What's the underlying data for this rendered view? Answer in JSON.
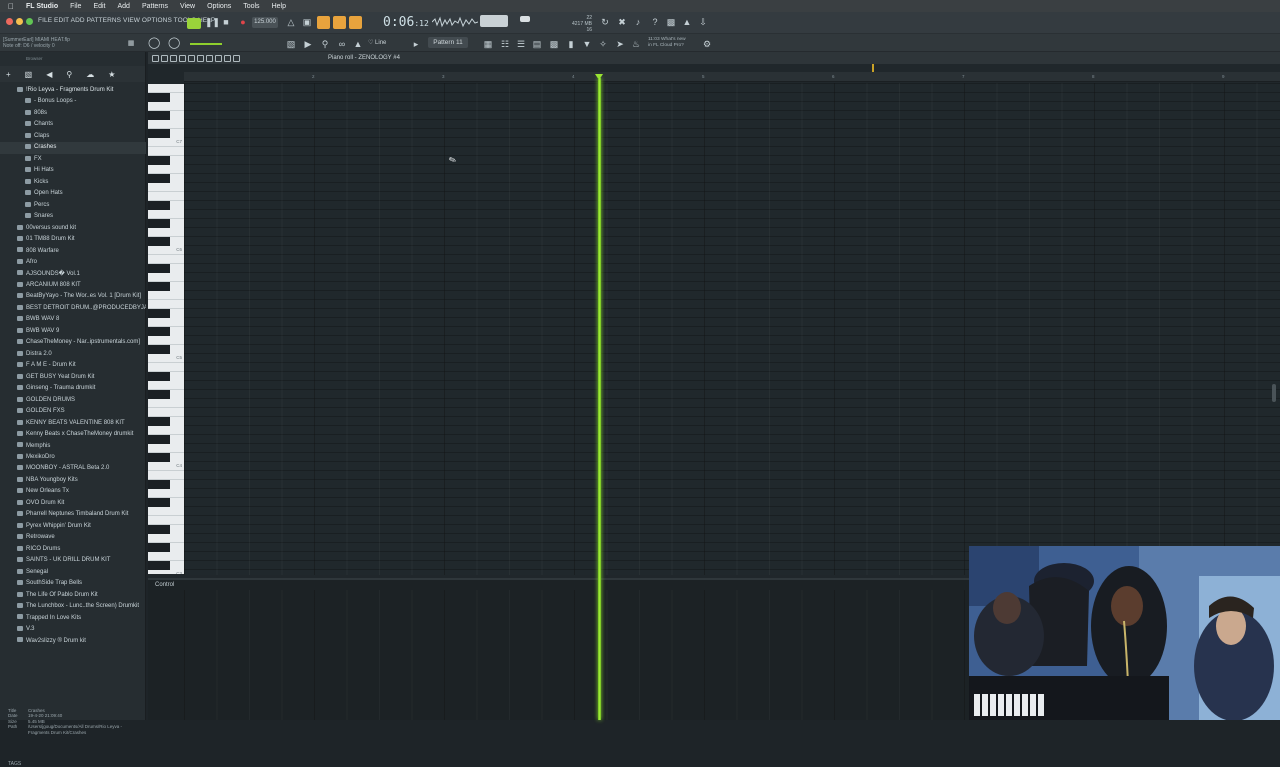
{
  "mac_menu": {
    "app": "FL Studio",
    "items": [
      "File",
      "Edit",
      "Add",
      "Patterns",
      "View",
      "Options",
      "Tools",
      "Help"
    ]
  },
  "fl_menu": "FILE EDIT ADD PATTERNS VIEW OPTIONS TOOLS HELP",
  "hint": {
    "file": "[SummerEarl] MIAMI HEAT.flp",
    "note": "Note off: D6 / velocity 0"
  },
  "transport": {
    "bpm": "125.000",
    "time": "0:06",
    "time_small": "12",
    "cpu": "22",
    "mem": "4217 MB",
    "voices": "16"
  },
  "pattern": "Pattern 11",
  "snap": "Line",
  "news": {
    "time": "11:03",
    "line1": "What's new",
    "line2": "in FL Cloud Pro?"
  },
  "piano_roll": {
    "title": "Piano roll - ZENOLOGY #4",
    "control": "Control",
    "ruler": [
      "2",
      "3",
      "4",
      "5",
      "6",
      "7",
      "8",
      "9"
    ],
    "octaves": [
      "C7",
      "C6",
      "C5",
      "C4",
      "C3"
    ]
  },
  "browser": {
    "header": "Browser",
    "tree": [
      {
        "label": "!Rio Leyva - Fragments Drum Kit",
        "depth": 0,
        "top": true
      },
      {
        "label": "- Bonus Loops -",
        "depth": 1
      },
      {
        "label": "808s",
        "depth": 1
      },
      {
        "label": "Chants",
        "depth": 1
      },
      {
        "label": "Claps",
        "depth": 1
      },
      {
        "label": "Crashes",
        "depth": 1,
        "selected": true
      },
      {
        "label": "FX",
        "depth": 1
      },
      {
        "label": "Hi Hats",
        "depth": 1
      },
      {
        "label": "Kicks",
        "depth": 1
      },
      {
        "label": "Open Hats",
        "depth": 1
      },
      {
        "label": "Percs",
        "depth": 1
      },
      {
        "label": "Snares",
        "depth": 1
      },
      {
        "label": "00versus sound kit",
        "depth": 0
      },
      {
        "label": "01 TM88 Drum Kit",
        "depth": 0
      },
      {
        "label": "808 Warfare",
        "depth": 0
      },
      {
        "label": "Afro",
        "depth": 0
      },
      {
        "label": "AJSOUNDS� Vol.1",
        "depth": 0
      },
      {
        "label": "ARCANIUM 808 KIT",
        "depth": 0
      },
      {
        "label": "BeatByYayo - The Wor..es Vol. 1 [Drum Kit]",
        "depth": 0
      },
      {
        "label": "BEST DETROIT DRUM..@PRODUCEDBYJAVEN",
        "depth": 0
      },
      {
        "label": "BWB WAV 8",
        "depth": 0
      },
      {
        "label": "BWB WAV 9",
        "depth": 0
      },
      {
        "label": "ChaseTheMoney - Nar..ipstrumentals.com]",
        "depth": 0
      },
      {
        "label": "Distra 2.0",
        "depth": 0
      },
      {
        "label": "F A M E - Drum Kit",
        "depth": 0
      },
      {
        "label": "GET BUSY Yeat Drum Kit",
        "depth": 0
      },
      {
        "label": "Ginseng - Trauma drumkit",
        "depth": 0
      },
      {
        "label": "GOLDEN DRUMS",
        "depth": 0
      },
      {
        "label": "GOLDEN FXS",
        "depth": 0
      },
      {
        "label": "KENNY BEATS VALENTINE 808 KIT",
        "depth": 0
      },
      {
        "label": "Kenny Beats x ChaseTheMoney drumkit",
        "depth": 0
      },
      {
        "label": "Memphis",
        "depth": 0
      },
      {
        "label": "MexikoDro",
        "depth": 0
      },
      {
        "label": "MOONBOY - ASTRAL Beta 2.0",
        "depth": 0
      },
      {
        "label": "NBA Youngboy Kits",
        "depth": 0
      },
      {
        "label": "New Orleans Tx",
        "depth": 0
      },
      {
        "label": "OVO Drum Kit",
        "depth": 0
      },
      {
        "label": "Pharrell Neptunes Timbaland Drum Kit",
        "depth": 0
      },
      {
        "label": "Pyrex Whippin' Drum Kit",
        "depth": 0
      },
      {
        "label": "Retrowave",
        "depth": 0
      },
      {
        "label": "RICO Drums",
        "depth": 0
      },
      {
        "label": "SAINTS - UK DRILL DRUM KIT",
        "depth": 0
      },
      {
        "label": "Senegal",
        "depth": 0
      },
      {
        "label": "SouthSide Trap Bells",
        "depth": 0
      },
      {
        "label": "The Life Of Pablo Drum Kit",
        "depth": 0
      },
      {
        "label": "The Lunchbox - Lunc..the Screen) Drumkit",
        "depth": 0
      },
      {
        "label": "Trapped In Love Kits",
        "depth": 0
      },
      {
        "label": "V.3",
        "depth": 0
      },
      {
        "label": "Wav2slizzy ® Drum kit",
        "depth": 0
      }
    ],
    "info": {
      "title_label": "Title",
      "title": "Crashes",
      "date_label": "Date",
      "date": "19-4-20 21:09:40",
      "size_label": "Size",
      "size": "5.45 MB",
      "path_label": "Path",
      "path": "/Users/jgoug/Documents/All Drums/Rio Leyva - Fragments Drum Kit/Crashes"
    },
    "tags": "TAGS"
  },
  "colors": {
    "playhead": "#9be434",
    "accent": "#e8a33d"
  }
}
